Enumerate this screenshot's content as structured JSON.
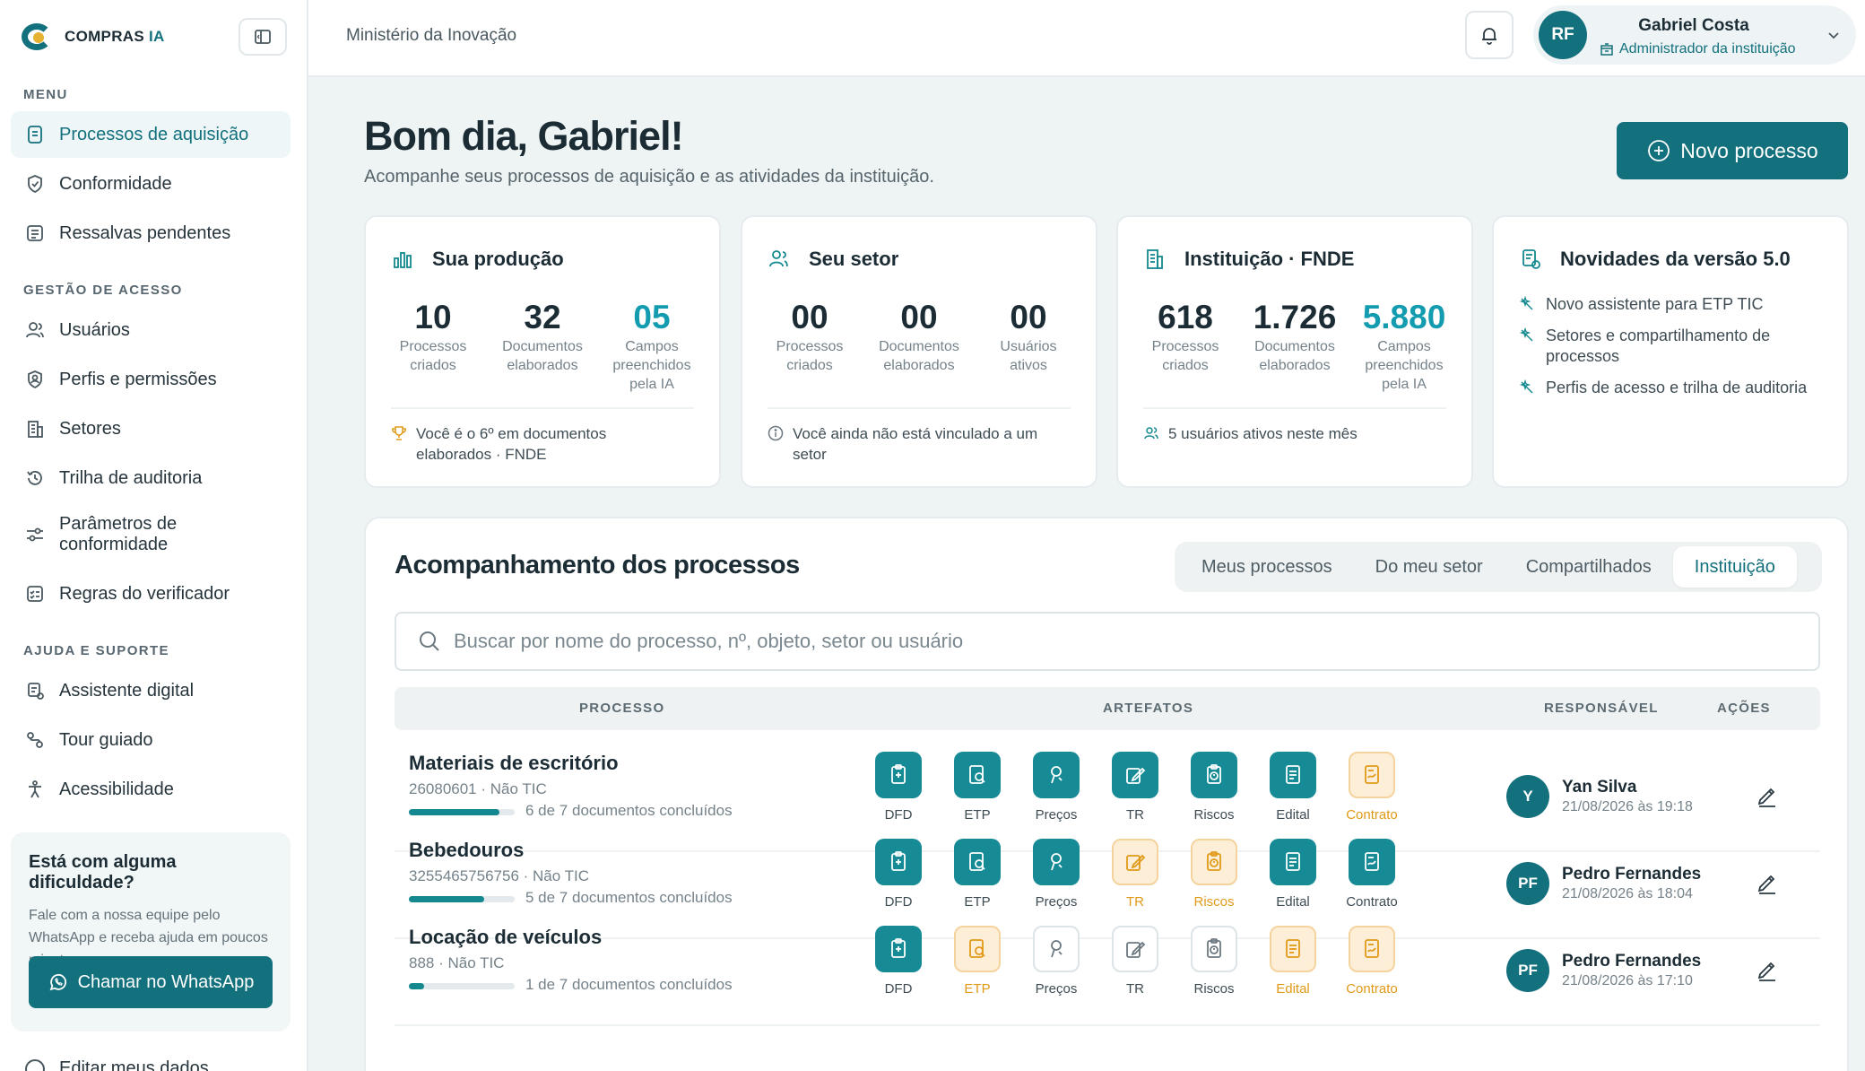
{
  "app": {
    "logo_text": "COMPRAS",
    "logo_suffix": "IA",
    "org_name": "Ministério da Inovação"
  },
  "sidebar": {
    "menu_title": "MENU",
    "menu_items": [
      {
        "label": "Processos de aquisição",
        "icon": "document-icon",
        "active": true
      },
      {
        "label": "Conformidade",
        "icon": "shield-check-icon"
      },
      {
        "label": "Ressalvas pendentes",
        "icon": "list-icon"
      }
    ],
    "access_title": "GESTÃO DE ACESSO",
    "access_items": [
      {
        "label": "Usuários",
        "icon": "users-icon"
      },
      {
        "label": "Perfis e permissões",
        "icon": "shield-user-icon"
      },
      {
        "label": "Setores",
        "icon": "building-icon"
      },
      {
        "label": "Trilha de auditoria",
        "icon": "history-icon"
      },
      {
        "label": "Parâmetros de conformidade",
        "line1": "Parâmetros de",
        "line2": "conformidade",
        "icon": "sliders-icon"
      },
      {
        "label": "Regras do verificador",
        "icon": "checklist-icon"
      }
    ],
    "support_title": "AJUDA E SUPORTE",
    "support_items": [
      {
        "label": "Assistente digital",
        "icon": "assistant-icon"
      },
      {
        "label": "Tour guiado",
        "icon": "route-icon"
      },
      {
        "label": "Acessibilidade",
        "icon": "accessibility-icon"
      }
    ],
    "help": {
      "title": "Está com alguma dificuldade?",
      "text": "Fale com a nossa equipe pelo WhatsApp e receba ajuda em poucos minutos.",
      "button": "Chamar no WhatsApp"
    },
    "cutoff_item": "Editar meus dados"
  },
  "topbar": {
    "user": {
      "initials": "RF",
      "name": "Gabriel Costa",
      "role": "Administrador da instituição"
    }
  },
  "header": {
    "greeting": "Bom dia, Gabriel!",
    "subtitle": "Acompanhe seus processos de aquisição e as atividades da instituição.",
    "new_button": "Novo processo"
  },
  "cards": {
    "producao": {
      "title": "Sua produção",
      "stats": [
        {
          "value": "10",
          "label1": "Processos",
          "label2": "criados",
          "label3": ""
        },
        {
          "value": "32",
          "label1": "Documentos",
          "label2": "elaborados",
          "label3": ""
        },
        {
          "value": "05",
          "label1": "Campos",
          "label2": "preenchidos",
          "label3": "pela IA"
        }
      ],
      "footer_line1": "Você é o 6º em documentos",
      "footer_line2": "elaborados · FNDE"
    },
    "setor": {
      "title": "Seu setor",
      "stats": [
        {
          "value": "00",
          "label1": "Processos",
          "label2": "criados"
        },
        {
          "value": "00",
          "label1": "Documentos",
          "label2": "elaborados"
        },
        {
          "value": "00",
          "label1": "Usuários",
          "label2": "ativos"
        }
      ],
      "footer_line1": "Você ainda não está vinculado a um",
      "footer_line2": "setor"
    },
    "instituicao": {
      "title": "Instituição · FNDE",
      "stats": [
        {
          "value": "618",
          "label1": "Processos",
          "label2": "criados",
          "label3": ""
        },
        {
          "value": "1.726",
          "label1": "Documentos",
          "label2": "elaborados",
          "label3": ""
        },
        {
          "value": "5.880",
          "label1": "Campos",
          "label2": "preenchidos",
          "label3": "pela IA"
        }
      ],
      "footer": "5 usuários ativos neste mês"
    },
    "novidades": {
      "title": "Novidades da versão 5.0",
      "items": [
        {
          "line1": "Novo assistente para ETP TIC",
          "line2": ""
        },
        {
          "line1": "Setores e compartilhamento de",
          "line2": "processos"
        },
        {
          "line1": "Perfis de acesso e trilha de auditoria",
          "line2": ""
        }
      ]
    }
  },
  "processes": {
    "title": "Acompanhamento dos processos",
    "tabs": [
      "Meus processos",
      "Do meu setor",
      "Compartilhados",
      "Instituição"
    ],
    "active_tab": "Instituição",
    "search_placeholder": "Buscar por nome do processo, nº, objeto, setor ou usuário",
    "columns": {
      "processo": "PROCESSO",
      "artefatos": "ARTEFATOS",
      "responsavel": "RESPONSÁVEL",
      "acoes": "AÇÕES"
    },
    "rows": [
      {
        "name": "Materiais de escritório",
        "meta": "26080601 · Não TIC",
        "progress": 0.857,
        "docs": "6 de 7 documentos concluídos",
        "artifacts": [
          {
            "label": "DFD",
            "status": "done"
          },
          {
            "label": "ETP",
            "status": "done"
          },
          {
            "label": "Preços",
            "status": "done"
          },
          {
            "label": "TR",
            "status": "done"
          },
          {
            "label": "Riscos",
            "status": "done"
          },
          {
            "label": "Edital",
            "status": "done"
          },
          {
            "label": "Contrato",
            "status": "pending"
          }
        ],
        "responsible": {
          "initials": "Y",
          "name": "Yan Silva",
          "date": "21/08/2026 às 19:18"
        }
      },
      {
        "name": "Bebedouros",
        "meta": "3255465756756 · Não TIC",
        "progress": 0.714,
        "docs": "5 de 7 documentos concluídos",
        "artifacts": [
          {
            "label": "DFD",
            "status": "done"
          },
          {
            "label": "ETP",
            "status": "done"
          },
          {
            "label": "Preços",
            "status": "done"
          },
          {
            "label": "TR",
            "status": "pending"
          },
          {
            "label": "Riscos",
            "status": "pending"
          },
          {
            "label": "Edital",
            "status": "done"
          },
          {
            "label": "Contrato",
            "status": "done"
          }
        ],
        "responsible": {
          "initials": "PF",
          "name": "Pedro Fernandes",
          "date": "21/08/2026 às 18:04"
        }
      },
      {
        "name": "Locação de veículos",
        "meta": "888 · Não TIC",
        "progress": 0.143,
        "docs": "1 de 7 documentos concluídos",
        "artifacts": [
          {
            "label": "DFD",
            "status": "done"
          },
          {
            "label": "ETP",
            "status": "pending"
          },
          {
            "label": "Preços",
            "status": "empty"
          },
          {
            "label": "TR",
            "status": "empty"
          },
          {
            "label": "Riscos",
            "status": "empty"
          },
          {
            "label": "Edital",
            "status": "pending"
          },
          {
            "label": "Contrato",
            "status": "pending"
          }
        ],
        "responsible": {
          "initials": "PF",
          "name": "Pedro Fernandes",
          "date": "21/08/2026 às 17:10"
        }
      }
    ]
  },
  "colors": {
    "primary": "#13707d",
    "accent_number": "#139cb0",
    "pending": "#e19a18",
    "done_box": "#168b96"
  }
}
